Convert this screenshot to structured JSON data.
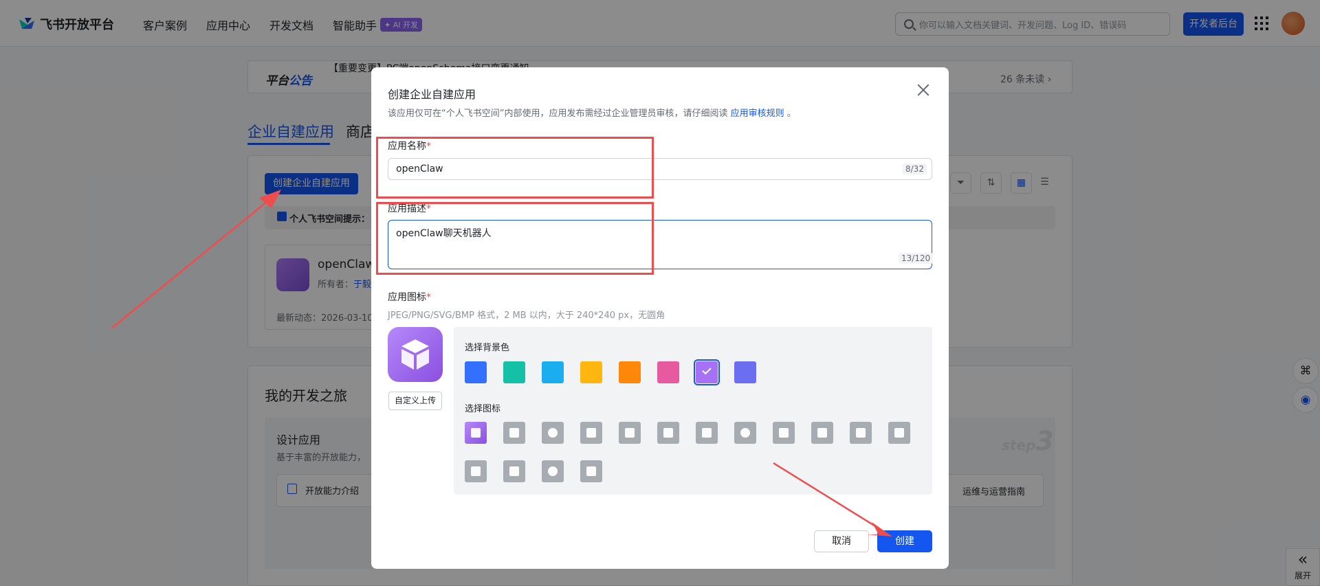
{
  "nav": {
    "logo_text": "飞书开放平台",
    "links": [
      "客户案例",
      "应用中心",
      "开发文档",
      "智能助手"
    ],
    "ai_badge": "✦ AI 开发",
    "search_placeholder": "你可以输入文档关键词、开发问题、Log ID、错误码",
    "dev_console": "开发者后台"
  },
  "notice": {
    "brand_a": "平台",
    "brand_b": "公告",
    "text": "【重要变更】PC端openSchema接口变更通知",
    "unread": "26 条未读 ›"
  },
  "tabs": {
    "active": "企业自建应用",
    "second": "商店"
  },
  "page": {
    "create_btn": "创建企业自建应用",
    "hint": "个人飞书空间提示：",
    "app_name": "openClaw",
    "owner_label": "所有者：",
    "owner_value": "于毅",
    "latest": "最新动态：2026-03-10",
    "journey_title": "我的开发之旅",
    "design_title": "设计应用",
    "design_desc": "基于丰富的开放能力，",
    "open_ability": "开放能力介绍",
    "ops_guide": "运维与运营指南",
    "step_label": "step",
    "step_num": "3"
  },
  "side": {
    "expand": "展开"
  },
  "modal": {
    "title": "创建企业自建应用",
    "desc": "该应用仅可在“个人飞书空间”内部使用，应用发布需经过企业管理员审核，请仔细阅读",
    "desc_link": "应用审核规则",
    "desc_end": "。",
    "name_label": "应用名称",
    "name_value": "openClaw",
    "name_count": "8/32",
    "desc_label": "应用描述",
    "desc_value": "openClaw聊天机器人",
    "desc_count": "13/120",
    "icon_label": "应用图标",
    "icon_hint": "JPEG/PNG/SVG/BMP 格式，2 MB 以内，大于 240*240 px，无圆角",
    "upload": "自定义上传",
    "bg_label": "选择背景色",
    "icon_pick_label": "选择图标",
    "bg_colors": [
      "#3370ff",
      "#14c0a6",
      "#1aaef0",
      "#ffb70f",
      "#ff880a",
      "#e85aa0",
      "#a671f4",
      "#6b6ef0"
    ],
    "selected_bg": 6,
    "icons": [
      "cube-icon",
      "robot-icon",
      "lightbulb-icon",
      "document-icon",
      "briefcase-icon",
      "bell-icon",
      "bookmark-icon",
      "pie-chart-icon",
      "star-icon",
      "tag-icon",
      "wrench-icon",
      "file-icon",
      "shield-check-icon",
      "layout-icon",
      "team-icon",
      "code-icon"
    ],
    "cancel": "取消",
    "create": "创建"
  }
}
